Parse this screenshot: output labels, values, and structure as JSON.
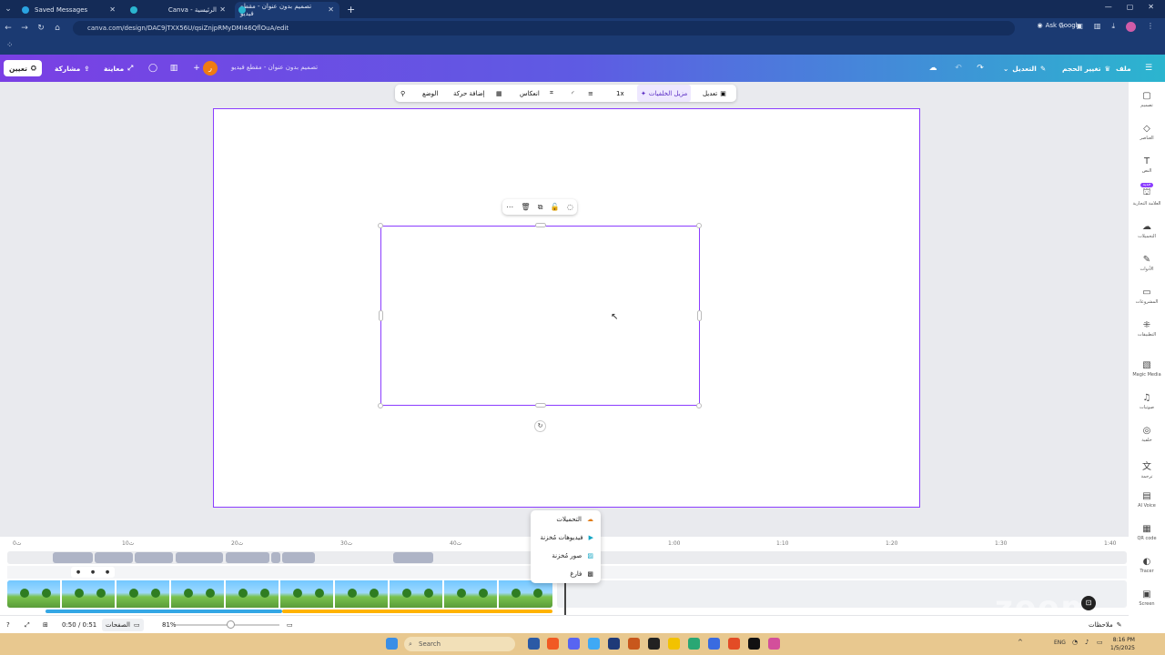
{
  "browser": {
    "tabs": [
      {
        "label": "Saved Messages",
        "active": false
      },
      {
        "label": "Canva - الرئيسية",
        "active": false
      },
      {
        "label": "تصميم بدون عنوان - مقطع فيديو",
        "active": true
      }
    ],
    "url": "canva.com/design/DAC9jTXX56U/qsiZnjpRMyDMI46QflOuA/edit",
    "ask_google": "Ask Google"
  },
  "header": {
    "menu_file": "ملف",
    "resize": "تغيير الحجم",
    "edit": "التعديل",
    "doc_title": "تصميم بدون عنوان - مقطع فيديو",
    "avatar_initial": "ر",
    "preview": "معاينة",
    "share": "مشاركة",
    "present": "تعيين"
  },
  "context_toolbar": {
    "edit": "تعديل",
    "bg_remover": "مزيل الخلفيات",
    "speed": "1x",
    "flip": "انعكاس",
    "animate": "إضافة حركة",
    "position": "الوضع"
  },
  "rail": {
    "items": [
      {
        "label": "تصميم",
        "icon": "layout-icon"
      },
      {
        "label": "العناصر",
        "icon": "elements-icon"
      },
      {
        "label": "النص",
        "icon": "text-icon"
      },
      {
        "label": "العلامة التجارية",
        "icon": "brand-icon",
        "badge": "جديد"
      },
      {
        "label": "التحميلات",
        "icon": "cloud-upload-icon"
      },
      {
        "label": "الأدوات",
        "icon": "pen-icon"
      },
      {
        "label": "المشروعات",
        "icon": "folder-icon"
      },
      {
        "label": "التطبيقات",
        "icon": "apps-icon"
      },
      {
        "label": "Magic Media",
        "icon": "magic-icon"
      },
      {
        "label": "صوتيات",
        "icon": "music-icon"
      },
      {
        "label": "خلفية",
        "icon": "background-icon"
      },
      {
        "label": "ترجمة",
        "icon": "translate-icon"
      },
      {
        "label": "AI Voice",
        "icon": "voice-icon"
      },
      {
        "label": "QR code",
        "icon": "qr-icon"
      },
      {
        "label": "Tracer",
        "icon": "tracer-icon"
      },
      {
        "label": "Screen",
        "icon": "screen-icon"
      }
    ]
  },
  "dropdown": {
    "items": [
      {
        "label": "التحميلات",
        "icon": "cloud-icon"
      },
      {
        "label": "فيديوهات مُخزنة",
        "icon": "video-icon"
      },
      {
        "label": "صور مُخزنة",
        "icon": "image-icon"
      },
      {
        "label": "فارغ",
        "icon": "empty-icon"
      }
    ]
  },
  "timeline": {
    "ticks": [
      "0ث",
      "10ث",
      "20ث",
      "30ث",
      "40ث",
      "1:00",
      "1:10",
      "1:20",
      "1:30",
      "1:40"
    ]
  },
  "footer": {
    "time": "0:50 / 0:51",
    "pages": "الصفحات",
    "zoom": "81%",
    "notes": "ملاحظات"
  },
  "taskbar": {
    "search_placeholder": "Search",
    "lang": "ENG",
    "clock_time": "8:16 PM",
    "clock_date": "1/5/2025"
  },
  "watermark": "zoom",
  "colors": {
    "accent": "#8b3dff",
    "header_start": "#7a3fe4",
    "header_end": "#2bb5cf"
  }
}
